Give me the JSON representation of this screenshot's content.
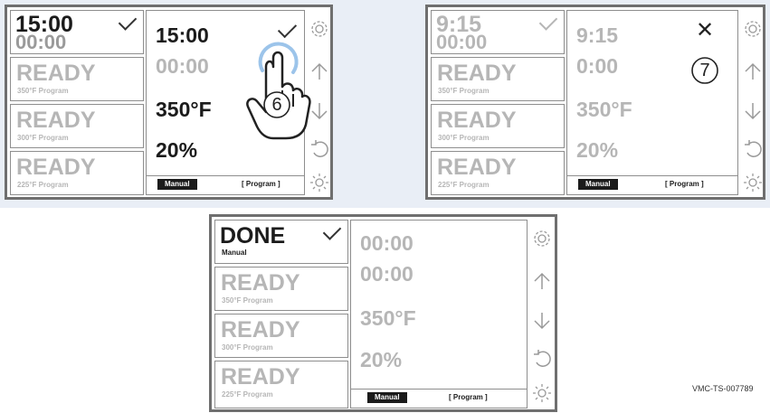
{
  "panels": [
    {
      "id": "panel-6",
      "slot1": {
        "line1": "15:00",
        "line2": "00:00"
      },
      "slots": [
        {
          "label": "READY",
          "sub": "350°F Program"
        },
        {
          "label": "READY",
          "sub": "300°F Program"
        },
        {
          "label": "READY",
          "sub": "225°F Program"
        }
      ],
      "main": {
        "time": "15:00",
        "elapsed": "00:00",
        "temp": "350°F",
        "fan": "20%"
      },
      "mode_manual": "Manual",
      "mode_program": "[ Program ]",
      "step": "6"
    },
    {
      "id": "panel-7",
      "slot1": {
        "line1": "9:15",
        "line2": "00:00"
      },
      "slots": [
        {
          "label": "READY",
          "sub": "350°F Program"
        },
        {
          "label": "READY",
          "sub": "300°F Program"
        },
        {
          "label": "READY",
          "sub": "225°F Program"
        }
      ],
      "main": {
        "time": "9:15",
        "elapsed": "0:00",
        "temp": "350°F",
        "fan": "20%"
      },
      "mode_manual": "Manual",
      "mode_program": "[ Program ]",
      "step": "7"
    },
    {
      "id": "panel-done",
      "slot1": {
        "line1": "DONE",
        "line2": "Manual"
      },
      "slots": [
        {
          "label": "READY",
          "sub": "350°F Program"
        },
        {
          "label": "READY",
          "sub": "300°F Program"
        },
        {
          "label": "READY",
          "sub": "225°F Program"
        }
      ],
      "main": {
        "time": "00:00",
        "elapsed": "00:00",
        "temp": "350°F",
        "fan": "20%"
      },
      "mode_manual": "Manual",
      "mode_program": "[ Program ]"
    }
  ],
  "icons": [
    "gear-icon",
    "arrow-up-icon",
    "arrow-down-icon",
    "reset-icon",
    "light-icon"
  ],
  "figure_code": "VMC-TS-007789",
  "colors": {
    "border": "#6f6f6f",
    "dark_text": "#1b1b1b",
    "faded_text": "#b6b6b6",
    "tap_highlight": "#9cc4ea"
  }
}
